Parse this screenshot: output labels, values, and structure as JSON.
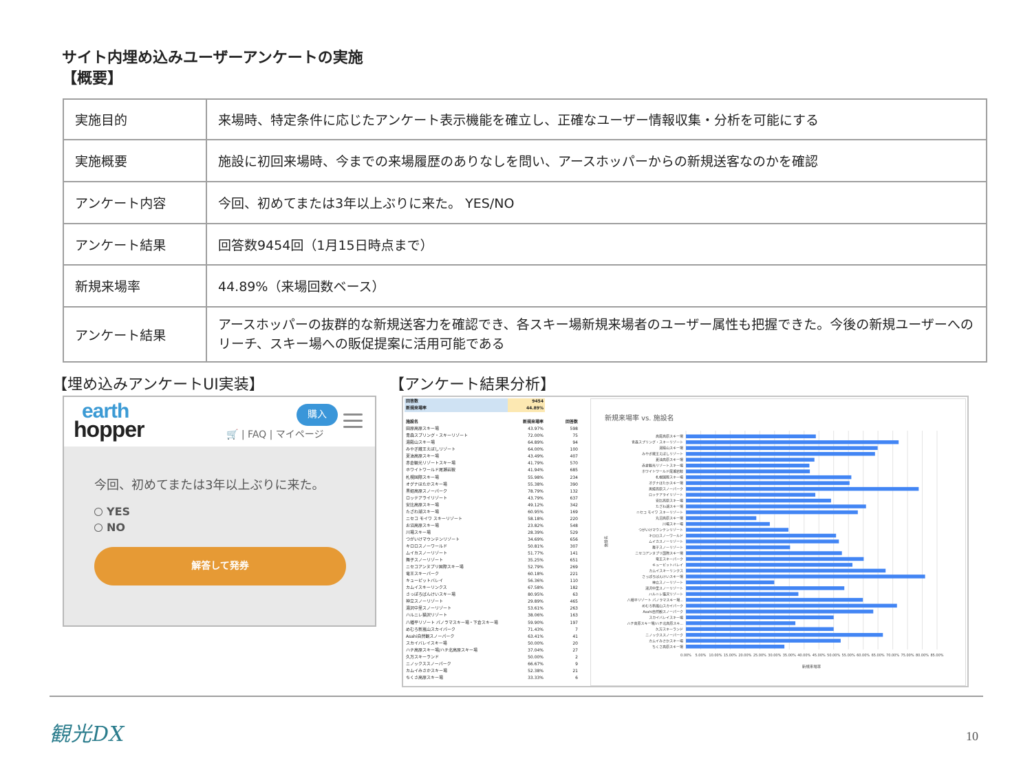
{
  "header": {
    "title_line1": "サイト内埋め込みユーザーアンケートの実施",
    "title_line2": "【概要】"
  },
  "overview": [
    {
      "label": "実施目的",
      "value": "来場時、特定条件に応じたアンケート表示機能を確立し、正確なユーザー情報収集・分析を可能にする"
    },
    {
      "label": "実施概要",
      "value": "施設に初回来場時、今までの来場履歴のありなしを問い、アースホッパーからの新規送客なのかを確認"
    },
    {
      "label": "アンケート内容",
      "value": "今回、初めてまたは3年以上ぶりに来た。 YES/NO"
    },
    {
      "label": "アンケート結果",
      "value": "回答数9454回（1月15日時点まで）"
    },
    {
      "label": "新規来場率",
      "value": "44.89%（来場回数ベース）"
    },
    {
      "label": "アンケート結果",
      "value": "アースホッパーの抜群的な新規送客力を確認でき、各スキー場新規来場者のユーザー属性も把握できた。今後の新規ユーザーへのリーチ、スキー場への販促提案に活用可能である"
    }
  ],
  "embed_section": {
    "heading": "【埋め込みアンケートUI実装】",
    "logo_line1": "earth",
    "logo_line2": "hopper",
    "buy_label": "購入",
    "nav_text": "🛒 | FAQ | マイページ",
    "question": "今回、初めてまたは3年以上ぶりに来た。",
    "option_yes": "YES",
    "option_no": "NO",
    "answer_button": "解答して発券"
  },
  "analysis_section": {
    "heading": "【アンケート結果分析】",
    "summary": [
      {
        "label": "回答数",
        "value": "9454"
      },
      {
        "label": "新規来場率",
        "value": "44.89%"
      }
    ],
    "columns": [
      "施設名",
      "新規来場率",
      "回答数"
    ],
    "rows": [
      [
        "田原高原スキー場",
        "43.97%",
        "598"
      ],
      [
        "青森スプリング・スキーリゾート",
        "72.00%",
        "75"
      ],
      [
        "湯殿山スキー場",
        "64.89%",
        "94"
      ],
      [
        "みやぎ蔵王えぼしリゾート",
        "64.00%",
        "100"
      ],
      [
        "夏油高原スキー場",
        "43.49%",
        "407"
      ],
      [
        "赤倉観光リゾートスキー場",
        "41.79%",
        "570"
      ],
      [
        "ホワイトワールド尾瀬岩鞍",
        "41.94%",
        "685"
      ],
      [
        "札幌国際スキー場",
        "55.98%",
        "234"
      ],
      [
        "オグナほたかスキー場",
        "55.38%",
        "390"
      ],
      [
        "黒姫高原スノーパーク",
        "78.79%",
        "132"
      ],
      [
        "ロッテアライリゾート",
        "43.79%",
        "637"
      ],
      [
        "安比高原スキー場",
        "49.12%",
        "342"
      ],
      [
        "たざわ湖スキー場",
        "60.95%",
        "169"
      ],
      [
        "ニセコ モイワ スキーリゾート",
        "58.18%",
        "220"
      ],
      [
        "お沼高原スキー場",
        "23.82%",
        "548"
      ],
      [
        "川場スキー場",
        "28.39%",
        "529"
      ],
      [
        "つがいけマウンテンリゾート",
        "34.69%",
        "656"
      ],
      [
        "キロロスノーワールド",
        "50.81%",
        "307"
      ],
      [
        "ムイカスノーリゾート",
        "51.77%",
        "141"
      ],
      [
        "舞子スノーリゾート",
        "35.25%",
        "651"
      ],
      [
        "ニセコアンヌプリ国際スキー場",
        "52.79%",
        "269"
      ],
      [
        "竜王スキーパーク",
        "60.18%",
        "221"
      ],
      [
        "キューピットバレイ",
        "56.36%",
        "110"
      ],
      [
        "カムイスキーリンクス",
        "67.58%",
        "182"
      ],
      [
        "さっぽろばんけいスキー場",
        "80.95%",
        "63"
      ],
      [
        "神立スノーリゾート",
        "29.89%",
        "465"
      ],
      [
        "湯沢中里スノーリゾート",
        "53.61%",
        "263"
      ],
      [
        "ハルニレ猫沢リゾート",
        "38.06%",
        "163"
      ],
      [
        "八幡平リゾート パノラマスキー場・下倉スキー場",
        "59.90%",
        "197"
      ],
      [
        "めむろ新嵐山スカイパーク",
        "71.43%",
        "7"
      ],
      [
        "Asahi自然観スノーパーク",
        "63.41%",
        "41"
      ],
      [
        "スカイバレイスキー場",
        "50.00%",
        "20"
      ],
      [
        "ハチ高原スキー場/ハチ北高原スキー場",
        "37.04%",
        "27"
      ],
      [
        "久万スキーランド",
        "50.00%",
        "2"
      ],
      [
        "ニノックススノーパーク",
        "66.67%",
        "9"
      ],
      [
        "カムイみさかスキー場",
        "52.38%",
        "21"
      ],
      [
        "ちくさ高原スキー場",
        "33.33%",
        "6"
      ]
    ]
  },
  "chart_data": {
    "type": "bar",
    "orientation": "horizontal",
    "title": "新規来場率 vs. 施設名",
    "xlabel": "新規来場率",
    "ylabel": "施設名",
    "xlim": [
      0,
      85
    ],
    "x_ticks": [
      "0.00%",
      "5.00%",
      "10.00%",
      "15.00%",
      "20.00%",
      "25.00%",
      "30.00%",
      "35.00%",
      "40.00%",
      "45.00%",
      "50.00%",
      "55.00%",
      "60.00%",
      "65.00%",
      "70.00%",
      "75.00%",
      "80.00%",
      "85.00%"
    ],
    "grid": true,
    "bar_color": "#4285f4",
    "categories": [
      "高尾高原スキー場",
      "青森スプリング・スキーリゾート",
      "湯殿山スキー場",
      "みやぎ蔵王えぼしリゾート",
      "夏油高原スキー場",
      "赤倉観光リゾートスキー場",
      "ホワイトワールド尾瀬岩鞍",
      "札幌国際スキー場",
      "オグナほたかスキー場",
      "黒姫高原スノーパーク",
      "ロッテアライリゾート",
      "安比高原スキー場",
      "たざわ湖スキー場",
      "ニセコ モイワ スキーリゾート",
      "丸沼高原スキー場",
      "川場スキー場",
      "つがいけマウンテンリゾート",
      "キロロスノーワールド",
      "ムイカスノーリゾート",
      "舞子スノーリゾート",
      "ニセコアンヌプリ国際スキー場",
      "竜王スキーパーク",
      "キューピットバレイ",
      "カムイスキーリンクス",
      "さっぽろばんけいスキー場",
      "神立スノーリゾート",
      "湯沢中里スノーリゾート",
      "ハルニレ猫沢リゾート",
      "八幡平リゾート パノラマスキー場...",
      "めむろ新嵐山スカイパーク",
      "Asahi自然観スノーパーク",
      "スカイバレイスキー場",
      "ハチ高原スキー場/ハチ北高原スキ...",
      "久万スキーランド",
      "ニノックススノーパーク",
      "カムイみさかスキー場",
      "ちくさ高原スキー場"
    ],
    "values": [
      43.97,
      72.0,
      64.89,
      64.0,
      43.49,
      41.79,
      41.94,
      55.98,
      55.38,
      78.79,
      43.79,
      49.12,
      60.95,
      58.18,
      23.82,
      28.39,
      34.69,
      50.81,
      51.77,
      35.25,
      52.79,
      60.18,
      56.36,
      67.58,
      80.95,
      29.89,
      53.61,
      38.06,
      59.9,
      71.43,
      63.41,
      50.0,
      37.04,
      50.0,
      66.67,
      52.38,
      33.33
    ]
  },
  "footer": {
    "logo_text": "観光DX",
    "page_number": "10"
  }
}
